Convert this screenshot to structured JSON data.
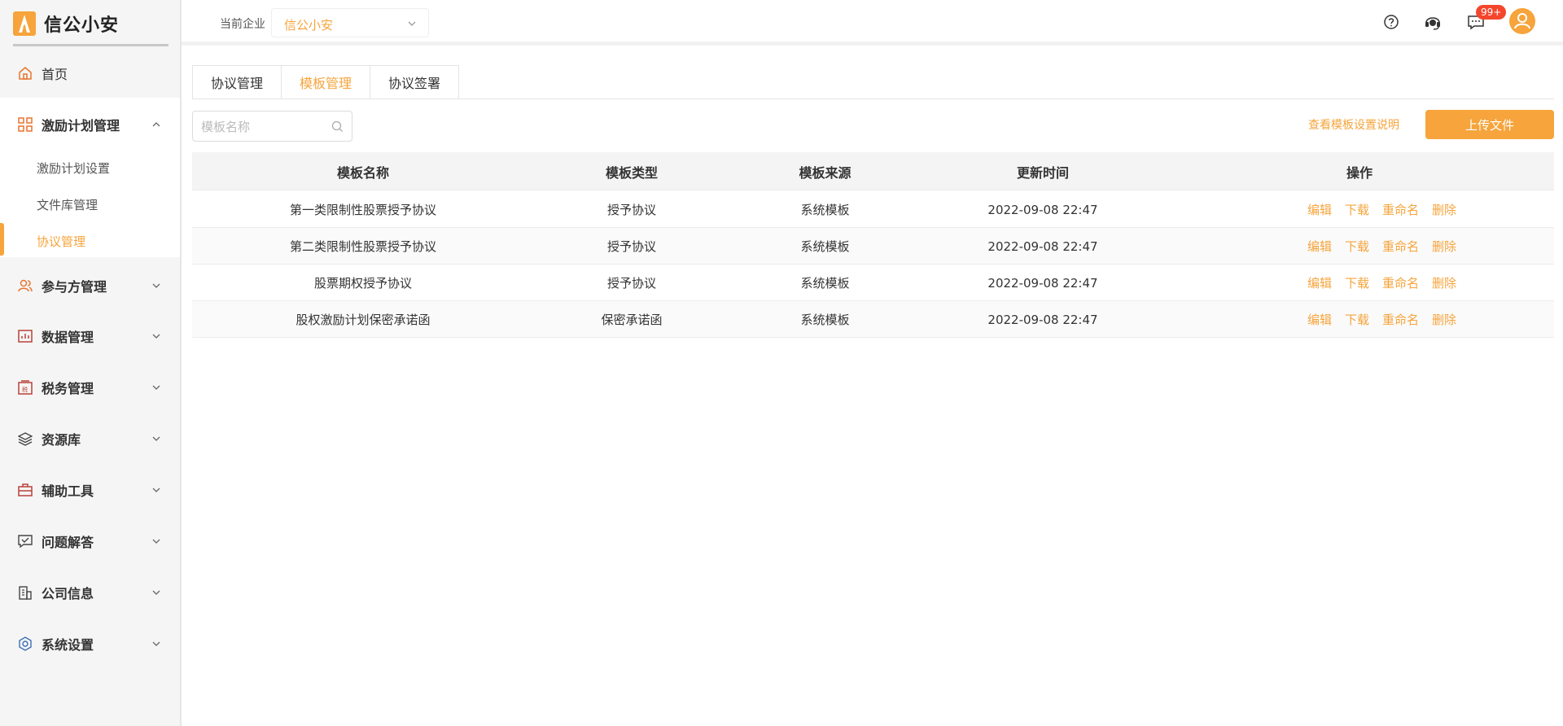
{
  "app": {
    "name": "信公小安"
  },
  "sidebar": {
    "items": [
      {
        "label": "首页",
        "icon": "home-icon"
      },
      {
        "label": "激励计划管理",
        "icon": "grid-icon",
        "expanded": true,
        "children": [
          {
            "label": "激励计划设置"
          },
          {
            "label": "文件库管理"
          },
          {
            "label": "协议管理",
            "active": true
          }
        ]
      },
      {
        "label": "参与方管理",
        "icon": "users-icon"
      },
      {
        "label": "数据管理",
        "icon": "chart-icon"
      },
      {
        "label": "税务管理",
        "icon": "tax-icon"
      },
      {
        "label": "资源库",
        "icon": "layers-icon"
      },
      {
        "label": "辅助工具",
        "icon": "toolbox-icon"
      },
      {
        "label": "问题解答",
        "icon": "qa-icon"
      },
      {
        "label": "公司信息",
        "icon": "building-icon"
      },
      {
        "label": "系统设置",
        "icon": "settings-icon"
      }
    ]
  },
  "header": {
    "company_label": "当前企业",
    "company_value": "信公小安",
    "badge": "99+",
    "icons": [
      "help-icon",
      "support-icon",
      "message-icon",
      "avatar"
    ]
  },
  "tabs": [
    {
      "label": "协议管理"
    },
    {
      "label": "模板管理",
      "active": true
    },
    {
      "label": "协议签署"
    }
  ],
  "toolbar": {
    "search_placeholder": "模板名称",
    "help_link": "查看模板设置说明",
    "upload_label": "上传文件"
  },
  "table": {
    "columns": [
      "模板名称",
      "模板类型",
      "模板来源",
      "更新时间",
      "操作"
    ],
    "actions": [
      "编辑",
      "下载",
      "重命名",
      "删除"
    ],
    "rows": [
      {
        "name": "第一类限制性股票授予协议",
        "type": "授予协议",
        "source": "系统模板",
        "updated": "2022-09-08 22:47"
      },
      {
        "name": "第二类限制性股票授予协议",
        "type": "授予协议",
        "source": "系统模板",
        "updated": "2022-09-08 22:47"
      },
      {
        "name": "股票期权授予协议",
        "type": "授予协议",
        "source": "系统模板",
        "updated": "2022-09-08 22:47"
      },
      {
        "name": "股权激励计划保密承诺函",
        "type": "保密承诺函",
        "source": "系统模板",
        "updated": "2022-09-08 22:47"
      }
    ]
  },
  "colors": {
    "accent": "#f6a43b",
    "badge": "#f5462d",
    "sidebar_bg": "#f5f5f5"
  }
}
